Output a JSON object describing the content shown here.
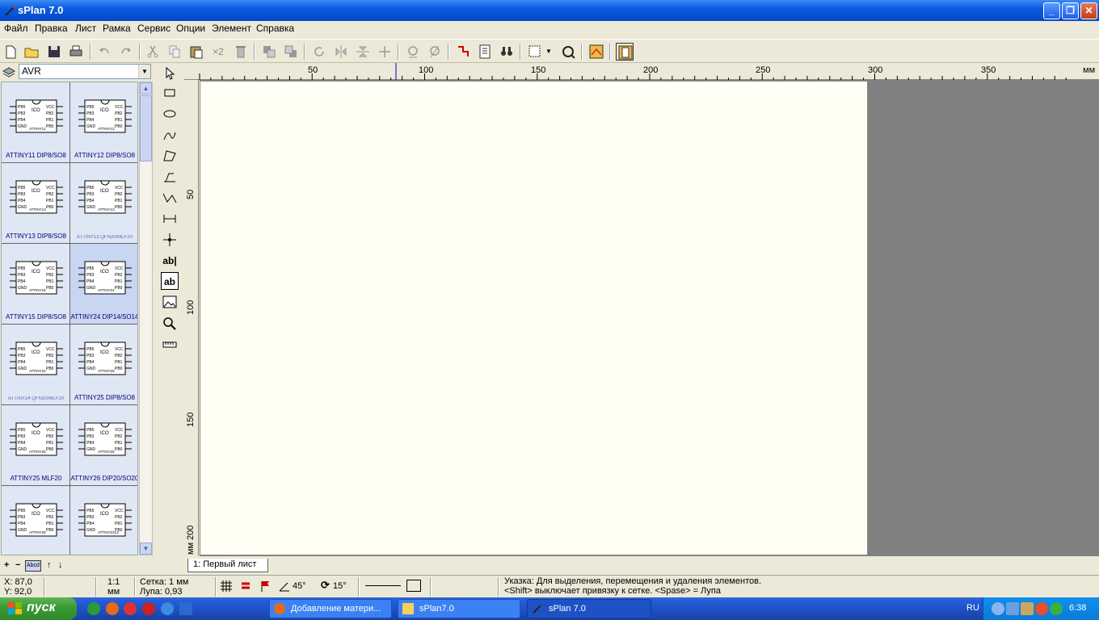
{
  "window": {
    "title": "sPlan 7.0",
    "controls": [
      "minimize",
      "maximize",
      "close"
    ]
  },
  "menu": [
    "Файл",
    "Правка",
    "Лист",
    "Рамка",
    "Сервис",
    "Опции",
    "Элемент",
    "Справка"
  ],
  "library": {
    "selected": "AVR",
    "items": [
      {
        "label": "ATTINY11 DIP8/SO8",
        "chip": "ATTINY11"
      },
      {
        "label": "ATTINY12 DIP8/SO8",
        "chip": "ATTINY12"
      },
      {
        "label": "ATTINY13 DIP8/SO8",
        "chip": "ATTINY13"
      },
      {
        "label": "ATTINY13 QFN20/MLF20",
        "chip": "ATTINY13"
      },
      {
        "label": "ATTINY15 DIP8/SO8",
        "chip": "ATTINY15"
      },
      {
        "label": "ATTINY24 DIP14/SO14",
        "chip": "ATTINY24",
        "selected": true
      },
      {
        "label": "ATTINY24 QFN20/MLF20",
        "chip": "ATTINY24"
      },
      {
        "label": "ATTINY25 DIP8/SO8",
        "chip": "ATTINY25"
      },
      {
        "label": "ATTINY25 MLF20",
        "chip": "ATTINY25"
      },
      {
        "label": "ATTINY26 DIP20/SO20",
        "chip": "ATTINY26"
      },
      {
        "label": "",
        "chip": "ATTINY28"
      },
      {
        "label": "",
        "chip": "ATTINY2313"
      }
    ],
    "pin_labels": {
      "left": [
        "PB5",
        "PB3",
        "PB4",
        "GND"
      ],
      "right": [
        "VCC",
        "PB2",
        "PB1",
        "PB0"
      ],
      "core": "ICO"
    }
  },
  "library_footer": [
    "+",
    "−",
    "Abcd",
    "↑",
    "↓"
  ],
  "ruler": {
    "top": [
      "50",
      "100",
      "150",
      "200",
      "250",
      "300",
      "350",
      "мм"
    ],
    "left": [
      "50",
      "100",
      "150",
      "200",
      "мм"
    ]
  },
  "sheet_tab": "1: Первый лист",
  "status": {
    "x": "X: 87,0",
    "y": "Y: 92,0",
    "scale": "1:1",
    "unit": "мм",
    "grid": "Сетка: 1 мм",
    "zoom": "Лупа:   0,93",
    "angle1": "45°",
    "angle2": "15°",
    "hint1": "Указка: Для выделения, перемещения и удаления элементов.",
    "hint2": "<Shift> выключает привязку к сетке. <Spase> = Лупа"
  },
  "taskbar": {
    "start": "пуск",
    "tasks": [
      "Добавление матери...",
      "sPlan7.0",
      "sPlan 7.0"
    ],
    "lang": "RU",
    "clock": "6:38"
  },
  "colors": {
    "titlebar": "#0a5be0",
    "paper": "#fffff4",
    "workspace": "#808080",
    "library": "#dfe6f4",
    "taskbar": "#245ddb",
    "start": "#3c9a36"
  }
}
